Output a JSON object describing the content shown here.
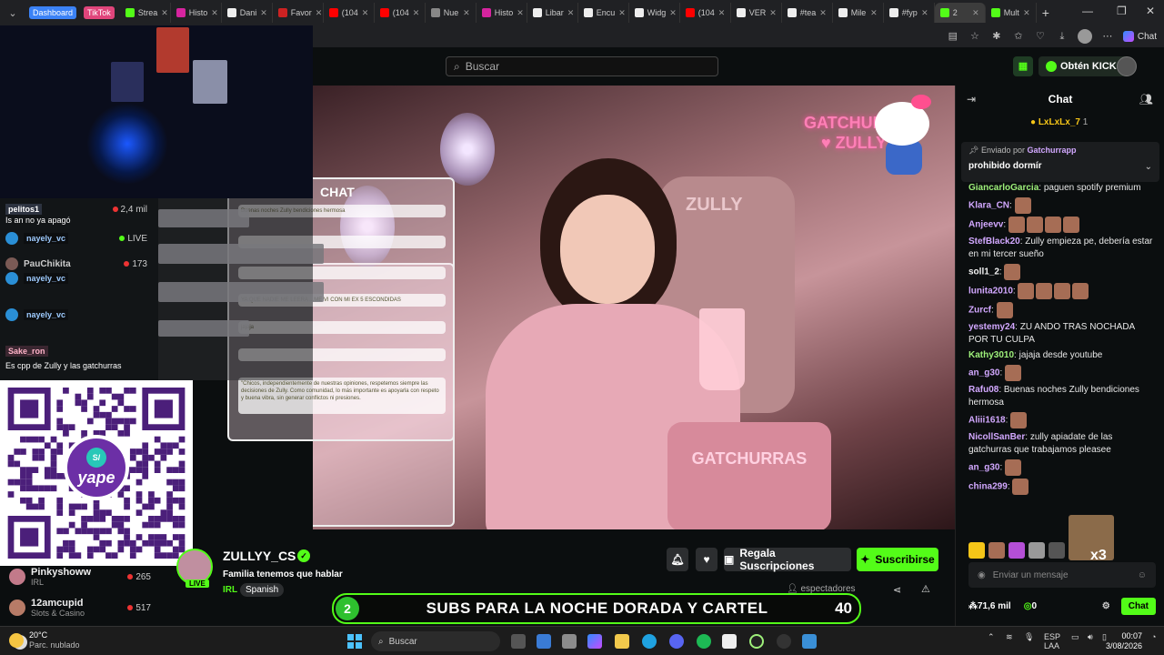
{
  "browser": {
    "groups": [
      {
        "label": "Dashboard",
        "color": "#3b82f6"
      },
      {
        "label": "TikTok",
        "color": "#e0457b"
      }
    ],
    "tabs": [
      {
        "label": "Strea",
        "color": "#53fc18"
      },
      {
        "label": "Histo",
        "color": "#d6249f"
      },
      {
        "label": "Dani",
        "color": "#eeeeee"
      },
      {
        "label": "Favor",
        "color": "#cc2222"
      },
      {
        "label": "(104",
        "color": "#ff0000"
      },
      {
        "label": "(104",
        "color": "#ff0000"
      },
      {
        "label": "Nue",
        "color": "#888888"
      },
      {
        "label": "Histo",
        "color": "#d6249f"
      },
      {
        "label": "Libar",
        "color": "#eeeeee"
      },
      {
        "label": "Encu",
        "color": "#eeeeee"
      },
      {
        "label": "Widg",
        "color": "#eeeeee"
      },
      {
        "label": "(104",
        "color": "#ff0000"
      },
      {
        "label": "VER",
        "color": "#eeeeee"
      },
      {
        "label": "#tea",
        "color": "#eeeeee"
      },
      {
        "label": "Mile",
        "color": "#eeeeee"
      },
      {
        "label": "#fyp",
        "color": "#eeeeee"
      },
      {
        "label": "2",
        "color": "#53fc18",
        "active": true
      },
      {
        "label": "Mult",
        "color": "#53fc18"
      }
    ],
    "toolbar_chat_label": "Chat"
  },
  "header": {
    "search_placeholder": "Buscar",
    "get_kicks_label": "Obtén KICKs"
  },
  "overlay": {
    "chat_title": "CHAT",
    "chat_lines": [
      "Buenas noches Zully bendiciones hermosa",
      "YA QUE NADIE ME LEERA ...ME VI CON MI EX 5 ESCONDIDAS",
      "jajaja",
      "\"Chicos, independientemente de nuestras opiniones, respetemos siempre las decisiones de Zully. Como comunidad, lo más importante es apoyarla con respeto y buena vibra, sin generar conflictos ni presiones."
    ],
    "neon_sign": "GATCHURROS ♥ ZULLY",
    "seat_text": "ZULLY",
    "pillow_text": "GATCHURRAS",
    "side_items": [
      {
        "name": "pelitos1",
        "count": "2,4 mil"
      },
      {
        "name": "Is an no ya apagó",
        "count": ""
      },
      {
        "name": "nayely_vc",
        "count": "LIVE"
      },
      {
        "name": "PauChikita",
        "count": "173"
      },
      {
        "name": "nayely_vc",
        "count": ""
      },
      {
        "name": "nayely_vc",
        "count": ""
      },
      {
        "name": "Sake_ron",
        "count": ""
      },
      {
        "name": "Es cpp de Zully y las gatchurras",
        "count": ""
      }
    ],
    "qr_brand": "yape",
    "qr_brand_mark": "S/"
  },
  "followed": [
    {
      "name": "Pinkyshoww",
      "sub": "IRL",
      "count": "265"
    },
    {
      "name": "12amcupid",
      "sub": "Slots & Casino",
      "count": "517"
    }
  ],
  "channel": {
    "name": "ZULLYY_CS",
    "title": "Familia tenemos que hablar",
    "category": "IRL",
    "language": "Spanish",
    "live_label": "LIVE",
    "gift_subs_label": "Regala Suscripciones",
    "subscribe_label": "Suscribirse",
    "viewers_label": "espectadores"
  },
  "banner": {
    "left": "2",
    "text": "SUBS PARA LA NOCHE DORADA Y CARTEL",
    "right": "40"
  },
  "chat": {
    "title": "Chat",
    "top_gifter": "LxLxLx_7",
    "top_gifter_count": "1",
    "pinned_by_label": "Enviado por",
    "pinned_by_user": "Gatchurrapp",
    "pinned_message": "prohibido dormír",
    "messages": [
      {
        "user": "GiancarloGarcia",
        "color": "#9ef07a",
        "text": "paguen spotify premium",
        "emotes": 0
      },
      {
        "user": "Klara_CN",
        "color": "#d2a8ff",
        "text": "",
        "emotes": 1
      },
      {
        "user": "Anjeevv",
        "color": "#d2a8ff",
        "text": "",
        "emotes": 4
      },
      {
        "user": "StefBlack20",
        "color": "#d2a8ff",
        "text": "Zully empieza pe, debería estar en mi tercer sueño",
        "emotes": 0
      },
      {
        "user": "soll1_2",
        "color": "#f2f2f2",
        "text": "",
        "emotes": 1
      },
      {
        "user": "lunita2010",
        "color": "#d2a8ff",
        "text": "",
        "emotes": 4
      },
      {
        "user": "Zurcf",
        "color": "#d2a8ff",
        "text": "",
        "emotes": 1
      },
      {
        "user": "yestemy24",
        "color": "#d2a8ff",
        "text": "ZU ANDO TRAS NOCHADA POR TU CULPA",
        "emotes": 0
      },
      {
        "user": "Kathy3010",
        "color": "#9ef07a",
        "text": "jajaja desde youtube",
        "emotes": 0
      },
      {
        "user": "an_g30",
        "color": "#d2a8ff",
        "text": "",
        "emotes": 1
      },
      {
        "user": "Rafu08",
        "color": "#d2a8ff",
        "text": "Buenas noches Zully bendiciones hermosa",
        "emotes": 0
      },
      {
        "user": "Aliii1618",
        "color": "#d2a8ff",
        "text": "",
        "emotes": 1
      },
      {
        "user": "NicollSanBer",
        "color": "#d2a8ff",
        "text": "zully apiadate de las gatchurras que trabajamos pleasee",
        "emotes": 0
      },
      {
        "user": "an_g30",
        "color": "#d2a8ff",
        "text": "",
        "emotes": 1
      },
      {
        "user": "china299",
        "color": "#d2a8ff",
        "text": "",
        "emotes": 1
      }
    ],
    "input_placeholder": "Enviar un mensaje",
    "kicks_count": "71,6 mil",
    "points": "0",
    "send_label": "Chat",
    "combo": "x3"
  },
  "taskbar": {
    "temperature": "20°C",
    "weather": "Parc. nublado",
    "search_label": "Buscar",
    "language": "ESP",
    "layout": "LAA",
    "time": "00:07",
    "date": "3/08/2026"
  },
  "colors": {
    "kick_green": "#53fc18",
    "bg": "#0b0e0f"
  }
}
